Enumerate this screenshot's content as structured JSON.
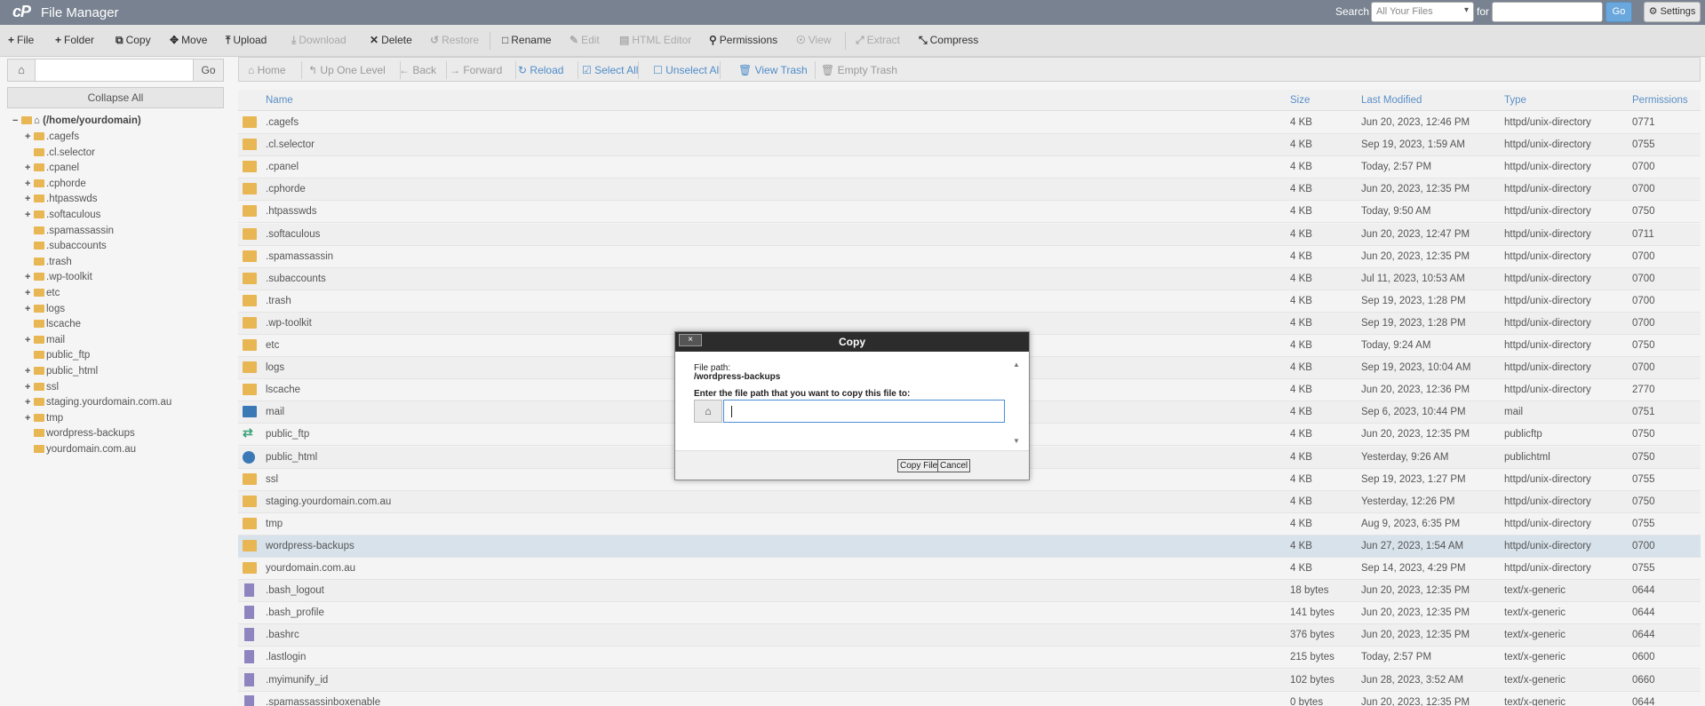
{
  "app": {
    "logo": "cP",
    "title": "File Manager"
  },
  "search": {
    "label": "Search",
    "scope": "All Your Files",
    "for_label": "for",
    "go": "Go",
    "settings": "Settings"
  },
  "toolbar": {
    "file": "File",
    "folder": "Folder",
    "copy": "Copy",
    "move": "Move",
    "upload": "Upload",
    "download": "Download",
    "delete": "Delete",
    "restore": "Restore",
    "rename": "Rename",
    "edit": "Edit",
    "html_editor": "HTML Editor",
    "permissions": "Permissions",
    "view": "View",
    "extract": "Extract",
    "compress": "Compress"
  },
  "left": {
    "go": "Go",
    "collapse": "Collapse All",
    "root": "(/home/yourdomain)"
  },
  "tree": [
    {
      "label": ".cagefs",
      "exp": "+"
    },
    {
      "label": ".cl.selector",
      "exp": ""
    },
    {
      "label": ".cpanel",
      "exp": "+"
    },
    {
      "label": ".cphorde",
      "exp": "+"
    },
    {
      "label": ".htpasswds",
      "exp": "+"
    },
    {
      "label": ".softaculous",
      "exp": "+"
    },
    {
      "label": ".spamassassin",
      "exp": ""
    },
    {
      "label": ".subaccounts",
      "exp": ""
    },
    {
      "label": ".trash",
      "exp": ""
    },
    {
      "label": ".wp-toolkit",
      "exp": "+"
    },
    {
      "label": "etc",
      "exp": "+"
    },
    {
      "label": "logs",
      "exp": "+"
    },
    {
      "label": "lscache",
      "exp": ""
    },
    {
      "label": "mail",
      "exp": "+"
    },
    {
      "label": "public_ftp",
      "exp": ""
    },
    {
      "label": "public_html",
      "exp": "+"
    },
    {
      "label": "ssl",
      "exp": "+"
    },
    {
      "label": "staging.yourdomain.com.au",
      "exp": "+"
    },
    {
      "label": "tmp",
      "exp": "+"
    },
    {
      "label": "wordpress-backups",
      "exp": ""
    },
    {
      "label": "yourdomain.com.au",
      "exp": ""
    }
  ],
  "nav": {
    "home": "Home",
    "up": "Up One Level",
    "back": "Back",
    "forward": "Forward",
    "reload": "Reload",
    "select_all": "Select All",
    "unselect_all": "Unselect All",
    "view_trash": "View Trash",
    "empty_trash": "Empty Trash"
  },
  "columns": {
    "name": "Name",
    "size": "Size",
    "modified": "Last Modified",
    "type": "Type",
    "perms": "Permissions"
  },
  "files": [
    {
      "name": ".cagefs",
      "size": "4 KB",
      "modified": "Jun 20, 2023, 12:46 PM",
      "type": "httpd/unix-directory",
      "perms": "0771",
      "icon": "folder-icon"
    },
    {
      "name": ".cl.selector",
      "size": "4 KB",
      "modified": "Sep 19, 2023, 1:59 AM",
      "type": "httpd/unix-directory",
      "perms": "0755",
      "icon": "folder-icon"
    },
    {
      "name": ".cpanel",
      "size": "4 KB",
      "modified": "Today, 2:57 PM",
      "type": "httpd/unix-directory",
      "perms": "0700",
      "icon": "folder-icon"
    },
    {
      "name": ".cphorde",
      "size": "4 KB",
      "modified": "Jun 20, 2023, 12:35 PM",
      "type": "httpd/unix-directory",
      "perms": "0700",
      "icon": "folder-icon"
    },
    {
      "name": ".htpasswds",
      "size": "4 KB",
      "modified": "Today, 9:50 AM",
      "type": "httpd/unix-directory",
      "perms": "0750",
      "icon": "folder-icon"
    },
    {
      "name": ".softaculous",
      "size": "4 KB",
      "modified": "Jun 20, 2023, 12:47 PM",
      "type": "httpd/unix-directory",
      "perms": "0711",
      "icon": "folder-icon"
    },
    {
      "name": ".spamassassin",
      "size": "4 KB",
      "modified": "Jun 20, 2023, 12:35 PM",
      "type": "httpd/unix-directory",
      "perms": "0700",
      "icon": "folder-icon"
    },
    {
      "name": ".subaccounts",
      "size": "4 KB",
      "modified": "Jul 11, 2023, 10:53 AM",
      "type": "httpd/unix-directory",
      "perms": "0700",
      "icon": "folder-icon"
    },
    {
      "name": ".trash",
      "size": "4 KB",
      "modified": "Sep 19, 2023, 1:28 PM",
      "type": "httpd/unix-directory",
      "perms": "0700",
      "icon": "folder-icon"
    },
    {
      "name": ".wp-toolkit",
      "size": "4 KB",
      "modified": "Sep 19, 2023, 1:28 PM",
      "type": "httpd/unix-directory",
      "perms": "0700",
      "icon": "folder-icon"
    },
    {
      "name": "etc",
      "size": "4 KB",
      "modified": "Today, 9:24 AM",
      "type": "httpd/unix-directory",
      "perms": "0750",
      "icon": "folder-icon"
    },
    {
      "name": "logs",
      "size": "4 KB",
      "modified": "Sep 19, 2023, 10:04 AM",
      "type": "httpd/unix-directory",
      "perms": "0700",
      "icon": "folder-icon"
    },
    {
      "name": "lscache",
      "size": "4 KB",
      "modified": "Jun 20, 2023, 12:36 PM",
      "type": "httpd/unix-directory",
      "perms": "2770",
      "icon": "folder-icon"
    },
    {
      "name": "mail",
      "size": "4 KB",
      "modified": "Sep 6, 2023, 10:44 PM",
      "type": "mail",
      "perms": "0751",
      "icon": "mail-icon"
    },
    {
      "name": "public_ftp",
      "size": "4 KB",
      "modified": "Jun 20, 2023, 12:35 PM",
      "type": "publicftp",
      "perms": "0750",
      "icon": "ftp-icon"
    },
    {
      "name": "public_html",
      "size": "4 KB",
      "modified": "Yesterday, 9:26 AM",
      "type": "publichtml",
      "perms": "0750",
      "icon": "globe-icon"
    },
    {
      "name": "ssl",
      "size": "4 KB",
      "modified": "Sep 19, 2023, 1:27 PM",
      "type": "httpd/unix-directory",
      "perms": "0755",
      "icon": "folder-icon"
    },
    {
      "name": "staging.yourdomain.com.au",
      "size": "4 KB",
      "modified": "Yesterday, 12:26 PM",
      "type": "httpd/unix-directory",
      "perms": "0750",
      "icon": "folder-icon"
    },
    {
      "name": "tmp",
      "size": "4 KB",
      "modified": "Aug 9, 2023, 6:35 PM",
      "type": "httpd/unix-directory",
      "perms": "0755",
      "icon": "folder-icon"
    },
    {
      "name": "wordpress-backups",
      "size": "4 KB",
      "modified": "Jun 27, 2023, 1:54 AM",
      "type": "httpd/unix-directory",
      "perms": "0700",
      "icon": "folder-icon",
      "selected": true
    },
    {
      "name": "yourdomain.com.au",
      "size": "4 KB",
      "modified": "Sep 14, 2023, 4:29 PM",
      "type": "httpd/unix-directory",
      "perms": "0755",
      "icon": "folder-icon"
    },
    {
      "name": ".bash_logout",
      "size": "18 bytes",
      "modified": "Jun 20, 2023, 12:35 PM",
      "type": "text/x-generic",
      "perms": "0644",
      "icon": "file-icon"
    },
    {
      "name": ".bash_profile",
      "size": "141 bytes",
      "modified": "Jun 20, 2023, 12:35 PM",
      "type": "text/x-generic",
      "perms": "0644",
      "icon": "file-icon"
    },
    {
      "name": ".bashrc",
      "size": "376 bytes",
      "modified": "Jun 20, 2023, 12:35 PM",
      "type": "text/x-generic",
      "perms": "0644",
      "icon": "file-icon"
    },
    {
      "name": ".lastlogin",
      "size": "215 bytes",
      "modified": "Today, 2:57 PM",
      "type": "text/x-generic",
      "perms": "0600",
      "icon": "file-icon"
    },
    {
      "name": ".myimunify_id",
      "size": "102 bytes",
      "modified": "Jun 28, 2023, 3:52 AM",
      "type": "text/x-generic",
      "perms": "0660",
      "icon": "file-icon"
    },
    {
      "name": ".spamassassinboxenable",
      "size": "0 bytes",
      "modified": "Jun 20, 2023, 12:35 PM",
      "type": "text/x-generic",
      "perms": "0644",
      "icon": "file-icon"
    }
  ],
  "dialog": {
    "title": "Copy",
    "close": "×",
    "file_path_label": "File path:",
    "file_path": "/wordpress-backups",
    "prompt": "Enter the file path that you want to copy this file to:",
    "input_value": "",
    "copy_button": "Copy Files",
    "cancel_button": "Cancel"
  },
  "colors": {
    "topbar": "#788290",
    "accent": "#4f8dc9",
    "folder": "#e8b653",
    "selected_row": "#d7e2ea"
  }
}
